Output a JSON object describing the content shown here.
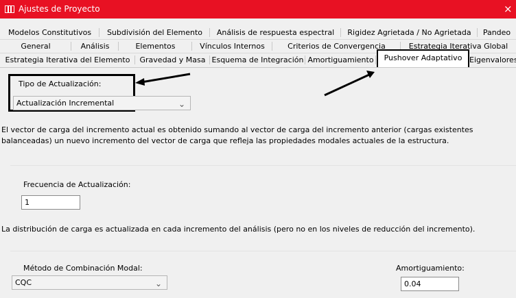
{
  "window": {
    "title": "Ajustes de Proyecto",
    "close_glyph": "×"
  },
  "tabs": {
    "row1": [
      "Modelos Constitutivos",
      "Subdivisión del Elemento",
      "Análisis de respuesta espectral",
      "Rigidez Agrietada / No Agrietada",
      "Pandeo"
    ],
    "row2": [
      "General",
      "Análisis",
      "Elementos",
      "Vínculos Internos",
      "Criterios de Convergencia",
      "Estrategia Iterativa Global"
    ],
    "row3": [
      "Estrategia Iterativa del Elemento",
      "Gravedad y Masa",
      "Esquema de Integración",
      "Amortiguamiento",
      "Pushover Adaptativo",
      "Eigenvalores"
    ],
    "active": "Pushover Adaptativo"
  },
  "update_type": {
    "label": "Tipo de Actualización:",
    "selected": "Actualización Incremental",
    "description": "El vector de carga del incremento actual es obtenido sumando al vector de carga del incremento anterior (cargas existentes balanceadas) un nuevo incremento del vector de carga que refleja las propiedades modales actuales de la estructura."
  },
  "update_frequency": {
    "label": "Frecuencia de Actualización:",
    "value": "1",
    "description": "La distribución de carga es actualizada en cada incremento del análisis (pero no en los niveles de reducción del incremento)."
  },
  "modal_combination": {
    "label": "Método de Combinación Modal:",
    "selected": "CQC"
  },
  "damping": {
    "label": "Amortiguamiento:",
    "value": "0.04"
  },
  "colors": {
    "titlebar": "#e81123",
    "annotation": "#000000"
  },
  "icons": {
    "app": "app-icon",
    "chevron": "chevron-down-icon",
    "close": "close-icon"
  }
}
